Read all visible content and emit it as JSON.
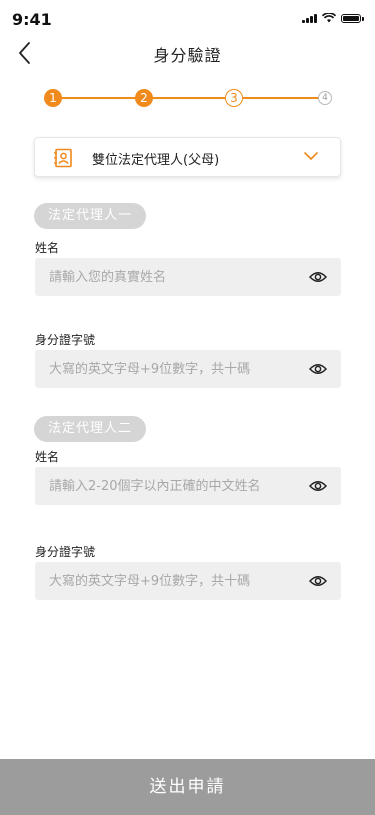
{
  "status_bar": {
    "time": "9:41"
  },
  "nav": {
    "title": "身分驗證"
  },
  "steps": [
    {
      "number": "1",
      "state": "done"
    },
    {
      "number": "2",
      "state": "done"
    },
    {
      "number": "3",
      "state": "current"
    },
    {
      "number": "4",
      "state": "pending"
    }
  ],
  "colors": {
    "accent": "#f08a1c",
    "badge_bg": "#d5d5d5",
    "field_bg": "#efefef",
    "submit_bg": "#9c9c9c"
  },
  "selector": {
    "icon": "contact-card-icon",
    "value": "雙位法定代理人(父母)"
  },
  "guardian_1": {
    "badge": "法定代理人一",
    "name_label": "姓名",
    "name_placeholder": "請輸入您的真實姓名",
    "id_label": "身分證字號",
    "id_placeholder": "大寫的英文字母+9位數字，共十碼"
  },
  "guardian_2": {
    "badge": "法定代理人二",
    "name_label": "姓名",
    "name_placeholder": "請輸入2-20個字以內正確的中文姓名",
    "id_label": "身分證字號",
    "id_placeholder": "大寫的英文字母+9位數字，共十碼"
  },
  "submit": {
    "label": "送出申請"
  }
}
